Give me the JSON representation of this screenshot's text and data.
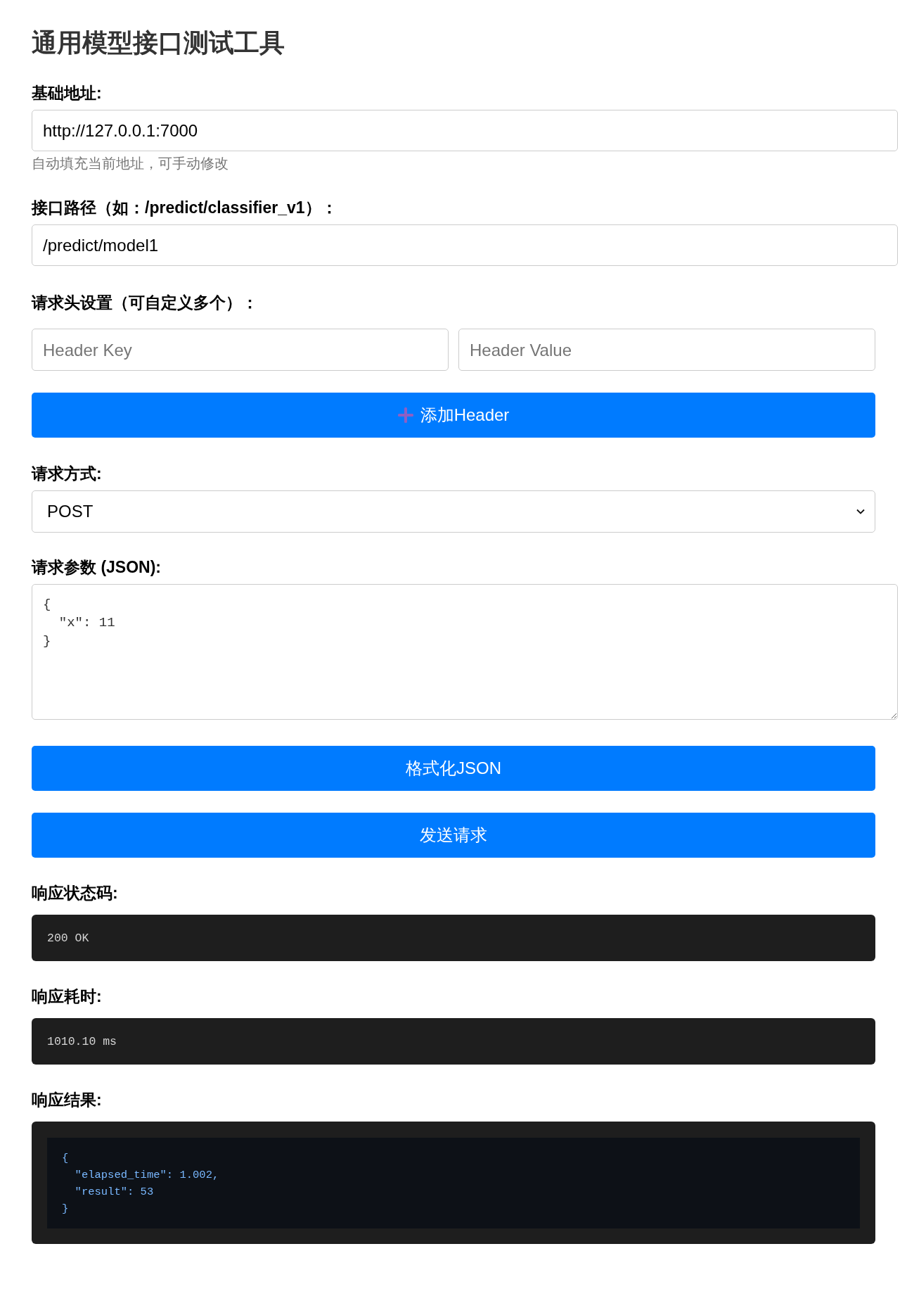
{
  "title": "通用模型接口测试工具",
  "base_url": {
    "label": "基础地址:",
    "value": "http://127.0.0.1:7000",
    "hint": "自动填充当前地址，可手动修改"
  },
  "api_path": {
    "label": "接口路径（如：/predict/classifier_v1）：",
    "value": "/predict/model1"
  },
  "headers": {
    "label": "请求头设置（可自定义多个）：",
    "rows": [
      {
        "key_placeholder": "Header Key",
        "value_placeholder": "Header Value"
      }
    ],
    "add_button": "添加Header"
  },
  "method": {
    "label": "请求方式:",
    "value": "POST"
  },
  "params": {
    "label": "请求参数 (JSON):",
    "value": "{\n  \"x\": 11\n}"
  },
  "actions": [
    {
      "label": "格式化JSON"
    },
    {
      "label": "发送请求"
    }
  ],
  "response": [
    {
      "kind": "text",
      "label": "响应状态码:",
      "value": "200 OK"
    },
    {
      "kind": "text",
      "label": "响应耗时:",
      "value": "1010.10 ms"
    },
    {
      "kind": "code",
      "label": "响应结果:",
      "value": "{\n  \"elapsed_time\": 1.002,\n  \"result\": 53\n}"
    }
  ]
}
